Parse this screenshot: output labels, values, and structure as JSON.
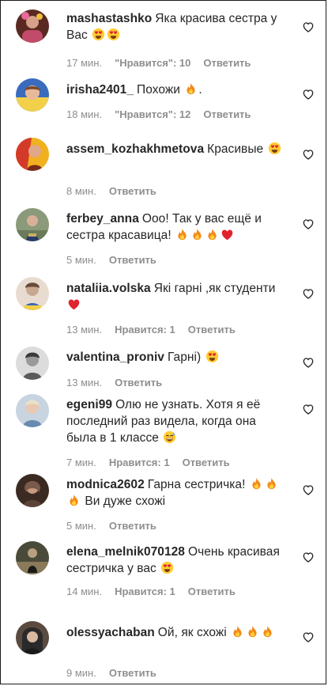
{
  "comments": [
    {
      "username": "mashastashko",
      "text": "Яка красива сестра у Вас",
      "time": "17 мин.",
      "likes": "\"Нравится\": 10",
      "reply": "Ответить",
      "emoji": [
        "heart-eyes-emoji",
        "heart-eyes-emoji"
      ],
      "avatar_colors": [
        "#6b3a2a",
        "#c98a7a",
        "#2c1810"
      ]
    },
    {
      "username": "irisha2401_",
      "text": "Похожи",
      "text_after": ".",
      "time": "18 мин.",
      "likes": "\"Нравится\": 12",
      "reply": "Ответить",
      "emoji": [
        "fire-emoji"
      ],
      "avatar_colors": [
        "#3a6bbd",
        "#e8b89a",
        "#f2d04a"
      ]
    },
    {
      "username": "assem_kozhakhmetova",
      "text": "Красивые",
      "time": "8 мин.",
      "reply": "Ответить",
      "emoji": [
        "heart-eyes-emoji"
      ],
      "avatar_colors": [
        "#d43a2a",
        "#f0b020",
        "#7a2a1a"
      ]
    },
    {
      "username": "ferbey_anna",
      "text": "Ооо! Так у вас ещё и сестра красавица!",
      "time": "5 мин.",
      "reply": "Ответить",
      "emoji": [
        "fire-emoji",
        "fire-emoji",
        "fire-emoji",
        "red-heart-emoji"
      ],
      "avatar_colors": [
        "#8a9a7a",
        "#2a3a6a",
        "#c8b060"
      ]
    },
    {
      "username": "nataliia.volska",
      "text": "Які гарні ,як студенти",
      "time": "13 мин.",
      "likes": "Нравится: 1",
      "reply": "Ответить",
      "emoji": [
        "red-heart-emoji"
      ],
      "avatar_colors": [
        "#e8dcd0",
        "#c8a890",
        "#3a6ab0"
      ]
    },
    {
      "username": "valentina_proniv",
      "text": "Гарні)",
      "time": "13 мин.",
      "reply": "Ответить",
      "emoji": [
        "heart-eyes-emoji"
      ],
      "avatar_colors": [
        "#9a9a9a",
        "#dcdcdc",
        "#3a3a3a"
      ]
    },
    {
      "username": "egeni99",
      "text": "Олю не узнать. Хотя я её последний раз видела, когда она была в 1 классе",
      "time": "7 мин.",
      "likes": "Нравится: 1",
      "reply": "Ответить",
      "emoji": [
        "grinning-sweat-emoji"
      ],
      "avatar_colors": [
        "#c8d4e0",
        "#e8c8b0",
        "#6a8ab0"
      ]
    },
    {
      "username": "modnica2602",
      "text": "Гарна сестричка!",
      "text_after": "Ви дуже схожі",
      "time": "5 мин.",
      "reply": "Ответить",
      "emoji": [
        "fire-emoji",
        "fire-emoji",
        "fire-emoji"
      ],
      "avatar_colors": [
        "#7a5a4a",
        "#c89a80",
        "#3a2a22"
      ]
    },
    {
      "username": "elena_melnik070128",
      "text": "Очень красивая сестричка у вас",
      "time": "14 мин.",
      "likes": "Нравится: 1",
      "reply": "Ответить",
      "emoji": [
        "heart-eyes-emoji"
      ],
      "avatar_colors": [
        "#4a4a3a",
        "#8a7a5a",
        "#1a1a1a"
      ]
    },
    {
      "username": "olessyachaban",
      "text": "Ой, як схожі",
      "time": "9 мин.",
      "reply": "Ответить",
      "emoji": [
        "fire-emoji",
        "fire-emoji",
        "fire-emoji"
      ],
      "avatar_colors": [
        "#2a2a2a",
        "#d8b8a0",
        "#5a4a40"
      ]
    }
  ],
  "colors": {
    "text": "#262626",
    "meta": "#8e8e8e",
    "fire": "#f28a1a",
    "heart": "#e0242e",
    "emoji_face": "#ffcc33"
  }
}
